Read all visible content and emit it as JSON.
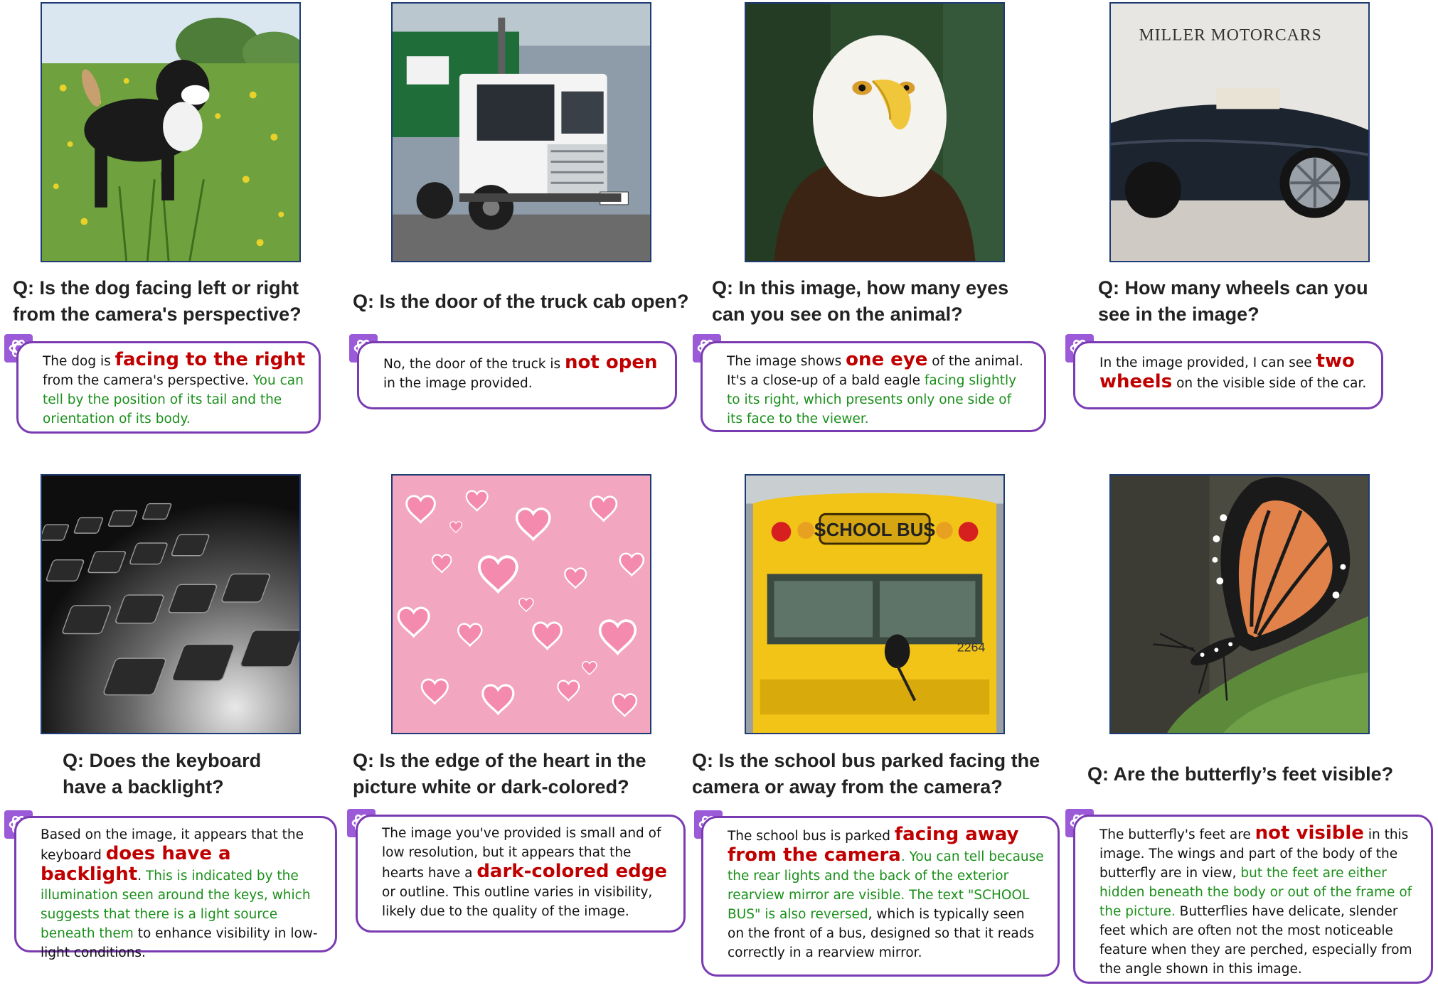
{
  "panels": [
    {
      "question": "Q: Is the dog facing left or right from the camera's perspective?",
      "answer": [
        {
          "text": "The dog is ",
          "style": "normal"
        },
        {
          "text": "facing to the right",
          "style": "highlight"
        },
        {
          "text": " from the camera's perspective. ",
          "style": "normal"
        },
        {
          "text": "You can tell by the position of its tail and the orientation of its body.",
          "style": "green"
        }
      ]
    },
    {
      "question": "Q: Is the door of the truck cab open?",
      "answer": [
        {
          "text": "No, the door of the truck is ",
          "style": "normal"
        },
        {
          "text": "not open",
          "style": "highlight"
        },
        {
          "text": " in the image provided.",
          "style": "normal"
        }
      ]
    },
    {
      "question": "Q: In this image, how many eyes can you see on the animal?",
      "answer": [
        {
          "text": "The image shows ",
          "style": "normal"
        },
        {
          "text": "one eye",
          "style": "highlight"
        },
        {
          "text": " of the animal. It's a close-up of a bald eagle ",
          "style": "normal"
        },
        {
          "text": "facing slightly to its right, which presents only one side of its face to the viewer.",
          "style": "green"
        }
      ]
    },
    {
      "question": "Q: How many wheels can you see in the image?",
      "answer": [
        {
          "text": "In the image provided, I can see ",
          "style": "normal"
        },
        {
          "text": "two wheels",
          "style": "highlight"
        },
        {
          "text": " on the visible side of the car.",
          "style": "normal"
        }
      ]
    },
    {
      "question": "Q: Does the keyboard have a backlight?",
      "answer": [
        {
          "text": "Based on the image, it appears that the keyboard ",
          "style": "normal"
        },
        {
          "text": "does have a backlight",
          "style": "highlight"
        },
        {
          "text": ". ",
          "style": "normal"
        },
        {
          "text": "This is indicated by the illumination seen around the keys, which suggests that there is a light source beneath them",
          "style": "green"
        },
        {
          "text": " to enhance visibility in low-light conditions.",
          "style": "normal"
        }
      ]
    },
    {
      "question": "Q: Is the edge of the heart in the picture white or dark-colored?",
      "answer": [
        {
          "text": "The image you've provided is small and of low resolution, but it appears that the hearts have a ",
          "style": "normal"
        },
        {
          "text": "dark-colored edge",
          "style": "highlight"
        },
        {
          "text": " or outline. This outline varies in visibility, likely due to the quality of the image.",
          "style": "normal"
        }
      ]
    },
    {
      "question": "Q: Is the school bus parked facing the camera or away from the camera?",
      "answer": [
        {
          "text": "The school bus is parked ",
          "style": "normal"
        },
        {
          "text": "facing away from the camera",
          "style": "highlight"
        },
        {
          "text": ". You can tell because the rear lights and the back of the exterior rearview mirror are visible. The text \"SCHOOL BUS\" is also reversed",
          "style": "green"
        },
        {
          "text": ", which is typically seen on the front of a bus, designed so that it reads correctly in a rearview mirror.",
          "style": "normal"
        }
      ]
    },
    {
      "question": "Q: Are the butterfly’s feet visible?",
      "answer": [
        {
          "text": "The butterfly's feet are ",
          "style": "normal"
        },
        {
          "text": "not visible",
          "style": "highlight"
        },
        {
          "text": " in this image. The wings and part of the body of the butterfly are in view, ",
          "style": "normal"
        },
        {
          "text": "but the feet are either hidden beneath the body or out of the frame of the picture.",
          "style": "green"
        },
        {
          "text": " Butterflies have delicate, slender feet which are often not the most noticeable feature when they are perched, especially from the angle shown in this image.",
          "style": "normal"
        }
      ]
    }
  ],
  "signs": {
    "motorcars": "MILLER MOTORCARS",
    "bus": "SCHOOL BUS",
    "bus_number": "2264"
  },
  "colors": {
    "highlight": "#c00000",
    "green": "#1a8f1a",
    "bubble_border": "#7a3bb2",
    "logo_bg": "#9b5ad8",
    "photo_border": "#1f3b73"
  },
  "icons": {
    "assistant": "chatgpt-logo-icon"
  }
}
